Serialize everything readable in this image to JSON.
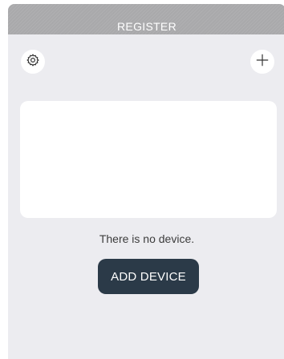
{
  "header": {
    "title": "REGISTER"
  },
  "toolbar": {
    "settings_icon": "gear-icon",
    "add_icon": "plus-icon"
  },
  "main": {
    "empty_message": "There is no device.",
    "add_device_label": "ADD DEVICE"
  },
  "colors": {
    "header_bg": "#a9a9ab",
    "page_bg": "#ececf0",
    "card_bg": "#ffffff",
    "primary_button": "#2b3a48"
  }
}
